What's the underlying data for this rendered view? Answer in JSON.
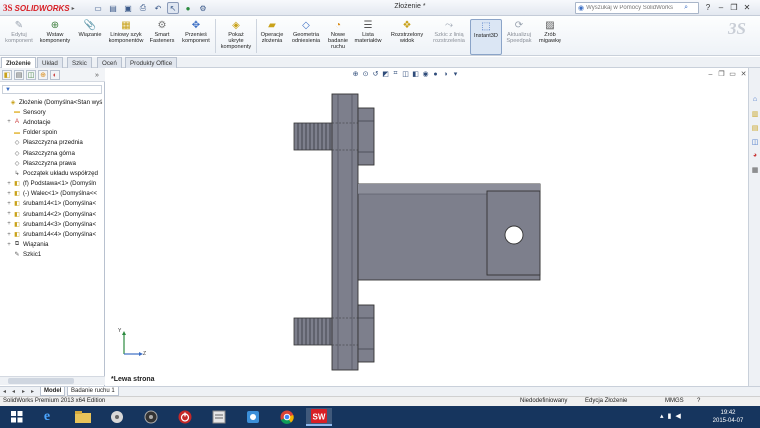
{
  "app": {
    "logo_brand": "SOLIDWORKS",
    "logo_ds": "3S",
    "document_title": "Złożenie *",
    "search_placeholder": "Wyszukaj w Pomocy SolidWorks"
  },
  "quick_access": [
    "new-icon",
    "open-icon",
    "save-icon",
    "print-icon",
    "undo-icon",
    "select-icon",
    "rebuild-icon",
    "options-icon"
  ],
  "ribbon": [
    {
      "label": "Edytuj\nkomponent",
      "icon": "edit-component-icon",
      "disabled": true
    },
    {
      "label": "Wstaw\nkomponenty",
      "icon": "insert-components-icon",
      "disabled": false
    },
    {
      "label": "Wiązanie",
      "icon": "mate-icon",
      "disabled": false
    },
    {
      "label": "Liniowy szyk\nkomponentów",
      "icon": "linear-pattern-icon",
      "disabled": false
    },
    {
      "label": "Smart\nFasteners",
      "icon": "smart-fasteners-icon",
      "disabled": false
    },
    {
      "label": "Przenieś\nkomponent",
      "icon": "move-component-icon",
      "disabled": false
    },
    {
      "label": "Pokaż\nukryte\nkomponenty",
      "icon": "show-hidden-icon",
      "disabled": false
    },
    {
      "label": "Operacje\nzłożenia",
      "icon": "assembly-features-icon",
      "disabled": false
    },
    {
      "label": "Geometria\nodniesienia",
      "icon": "reference-geometry-icon",
      "disabled": false
    },
    {
      "label": "Nowe\nbadanie\nruchu",
      "icon": "new-motion-study-icon",
      "disabled": false
    },
    {
      "label": "Lista\nmateriałów",
      "icon": "bom-icon",
      "disabled": false
    },
    {
      "label": "Rozstrzelony\nwidok",
      "icon": "exploded-view-icon",
      "disabled": false
    },
    {
      "label": "Szkic z linią\nrozstrzelenia",
      "icon": "explode-line-sketch-icon",
      "disabled": true
    },
    {
      "label": "Instant3D",
      "icon": "instant3d-icon",
      "disabled": false,
      "active": true
    },
    {
      "label": "Aktualizuj\nSpeedpak",
      "icon": "update-speedpak-icon",
      "disabled": true
    },
    {
      "label": "Zrób\nmigawkę",
      "icon": "snapshot-icon",
      "disabled": false
    }
  ],
  "tabs": [
    "Złożenie",
    "Układ",
    "Szkic",
    "Oceń",
    "Produkty Office"
  ],
  "feature_tree": [
    {
      "label": "Złożenie  (Domyślna<Stan wyś",
      "icon": "assembly-icon",
      "expander": ""
    },
    {
      "label": "Sensory",
      "icon": "folder-icon",
      "expander": ""
    },
    {
      "label": "Adnotacje",
      "icon": "annotation-icon",
      "expander": "+"
    },
    {
      "label": "Folder spoin",
      "icon": "folder-icon",
      "expander": ""
    },
    {
      "label": "Płaszczyzna przednia",
      "icon": "plane-icon",
      "expander": ""
    },
    {
      "label": "Płaszczyzna górna",
      "icon": "plane-icon",
      "expander": ""
    },
    {
      "label": "Płaszczyzna prawa",
      "icon": "plane-icon",
      "expander": ""
    },
    {
      "label": "Początek układu współrzęd",
      "icon": "origin-icon",
      "expander": ""
    },
    {
      "label": "(f) Podstawa<1> (Domyśln",
      "icon": "part-icon",
      "expander": "+"
    },
    {
      "label": "(-) Walec<1> (Domyślna<<",
      "icon": "part-icon",
      "expander": "+"
    },
    {
      "label": "śrubam14<1> (Domyślna<",
      "icon": "part-icon",
      "expander": "+"
    },
    {
      "label": "śrubam14<2> (Domyślna<",
      "icon": "part-icon",
      "expander": "+"
    },
    {
      "label": "śrubam14<3> (Domyślna<",
      "icon": "part-icon",
      "expander": "+"
    },
    {
      "label": "śrubam14<4> (Domyślna<",
      "icon": "part-icon",
      "expander": "+"
    },
    {
      "label": "Wiązania",
      "icon": "mates-icon",
      "expander": "+"
    },
    {
      "label": "Szkic1",
      "icon": "sketch-icon",
      "expander": ""
    }
  ],
  "viewport": {
    "view_label": "*Lewa strona",
    "triad": {
      "x": "X",
      "y": "Y",
      "z": "Z"
    }
  },
  "model_tabs": [
    "Model",
    "Badanie ruchu 1"
  ],
  "status": {
    "edition": "SolidWorks Premium 2013 x64 Edition",
    "state": "Niedodefiniowany",
    "mode": "Edycja Złożenie",
    "units": "MMGS"
  },
  "clock": {
    "time": "19:42",
    "date": "2015-04-07"
  },
  "colors": {
    "part_fill": "#7d7f8c",
    "part_dark": "#5e606c",
    "brand_red": "#d81f26",
    "taskbar": "#16355e"
  }
}
